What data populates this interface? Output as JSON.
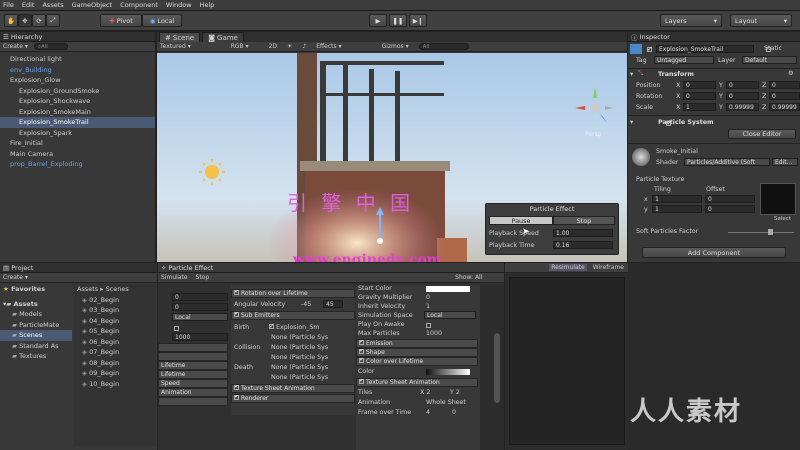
{
  "menu": [
    "File",
    "Edit",
    "Assets",
    "GameObject",
    "Component",
    "Window",
    "Help"
  ],
  "toolbar": {
    "pivot": "Pivot",
    "local": "Local",
    "layers": "Layers",
    "layout": "Layout"
  },
  "hierarchy": {
    "title": "Hierarchy",
    "create": "Create",
    "search": "All",
    "items": [
      {
        "label": "Directional light",
        "style": "normal"
      },
      {
        "label": "env_Building",
        "style": "blue"
      },
      {
        "label": "Explosion_Glow",
        "style": "parent"
      },
      {
        "label": "Explosion_GroundSmoke",
        "style": "child"
      },
      {
        "label": "Explosion_Shockwave",
        "style": "child"
      },
      {
        "label": "Explosion_SmokeMain",
        "style": "child"
      },
      {
        "label": "Explosion_SmokeTrail",
        "style": "child-selected"
      },
      {
        "label": "Explosion_Spark",
        "style": "child"
      },
      {
        "label": "Fire_Initial",
        "style": "parent"
      },
      {
        "label": "Main Camera",
        "style": "normal"
      },
      {
        "label": "prop_Barrel_Exploding",
        "style": "blue"
      }
    ]
  },
  "scene": {
    "tab_scene": "Scene",
    "tab_game": "Game",
    "textured": "Textured",
    "rgb": "RGB",
    "mode2d": "2D",
    "effects": "Effects",
    "gizmos": "Gizmos",
    "search": "All",
    "persp": "Persp",
    "watermark1": "引  擎  中  国",
    "watermark2": "www.enginedx.com",
    "particle_effect": {
      "title": "Particle Effect",
      "pause": "Pause",
      "stop": "Stop",
      "speed_label": "Playback Speed",
      "speed_value": "1.00",
      "time_label": "Playback Time",
      "time_value": "0.16"
    }
  },
  "inspector": {
    "title": "Inspector",
    "object_name": "Explosion_SmokeTrail",
    "static": "Static",
    "tag_label": "Tag",
    "tag_value": "Untagged",
    "layer_label": "Layer",
    "layer_value": "Default",
    "transform": "Transform",
    "position": {
      "label": "Position",
      "x": "0",
      "y": "0",
      "z": "0"
    },
    "rotation": {
      "label": "Rotation",
      "x": "0",
      "y": "0",
      "z": "0"
    },
    "scale": {
      "label": "Scale",
      "x": "1",
      "y": "0.99999",
      "z": "0.99999"
    },
    "particle_system": "Particle System",
    "close_editor": "Close Editor",
    "material": "Smoke_Initial",
    "shader_label": "Shader",
    "shader_value": "Particles/Additive (Soft",
    "edit": "Edit...",
    "particle_texture": "Particle Texture",
    "tiling": "Tiling",
    "offset": "Offset",
    "tx": "x",
    "ty": "y",
    "tile_x": "1",
    "tile_y": "1",
    "off_x": "0",
    "off_y": "0",
    "select": "Select",
    "soft_particles": "Soft Particles Factor",
    "add_component": "Add Component"
  },
  "project": {
    "title": "Project",
    "create": "Create",
    "favorites": "Favorites",
    "assets_root": "Assets",
    "tree": [
      "Models",
      "ParticleMate",
      "Scenes",
      "Standard As",
      "Textures"
    ],
    "crumb_assets": "Assets",
    "crumb_scenes": "Scenes",
    "files": [
      "02_Begin",
      "03_Begin",
      "04_Begin",
      "05_Begin",
      "06_Begin",
      "07_Begin",
      "08_Begin",
      "09_Begin",
      "10_Begin"
    ]
  },
  "particle_panel": {
    "title": "Particle Effect",
    "simulate": "Simulate",
    "stop": "Stop",
    "show_all": "Show: All",
    "resimulate": "Resimulate",
    "wireframe": "Wireframe",
    "left_values": [
      "0",
      "0",
      "Local",
      "",
      "1000"
    ],
    "left_modules": [
      "Lifetime",
      "Lifetime",
      "Speed",
      "Animation"
    ],
    "rotation_over_lifetime": "Rotation over Lifetime",
    "angular_velocity": "Angular Velocity",
    "av_min": "-45",
    "av_max": "45",
    "sub_emitters": "Sub Emitters",
    "birth": "Birth",
    "collision": "Collision",
    "death": "Death",
    "birth_value": "Explosion_Sm",
    "none_value": "None (Particle Sys",
    "texture_sheet": "Texture Sheet Animation",
    "renderer": "Renderer",
    "start_color": "Start Color",
    "gravity_multiplier": "Gravity Multiplier",
    "gravity_value": "0",
    "inherit_velocity": "Inherit Velocity",
    "inherit_value": "1",
    "simulation_space": "Simulation Space",
    "simulation_value": "Local",
    "play_on_awake": "Play On Awake",
    "max_particles": "Max Particles",
    "max_value": "1000",
    "emission": "Emission",
    "shape": "Shape",
    "color_over_lifetime": "Color over Lifetime",
    "color": "Color",
    "tsa": "Texture Sheet Animation",
    "tiles": "Tiles",
    "tiles_x": "X 2",
    "tiles_y": "Y 2",
    "animation": "Animation",
    "animation_value": "Whole Sheet",
    "frame_over_time": "Frame over Time",
    "frame_value": "4",
    "frame_zero": "0"
  },
  "watermark_corner": "人人素材"
}
